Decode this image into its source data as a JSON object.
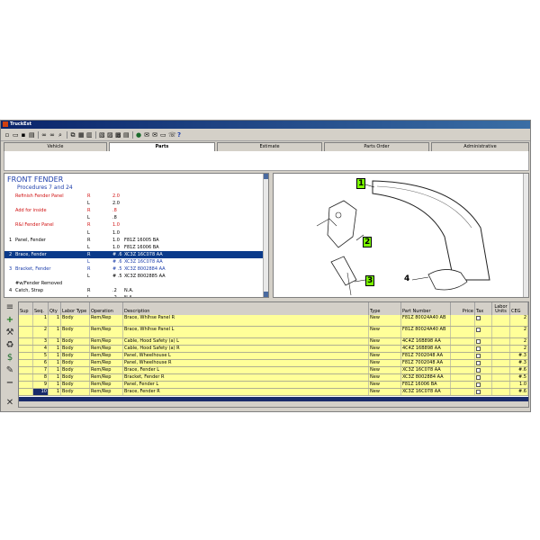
{
  "window": {
    "title": "TruckEst"
  },
  "toolbar": {
    "icons": [
      "new-icon",
      "open-icon",
      "save-icon",
      "print-icon",
      "binoculars-icon",
      "binoculars-prev-icon",
      "zoom-icon",
      "copy-icon",
      "paste-icon",
      "clipboard-icon",
      "image-icon",
      "picture-icon",
      "calculator-icon",
      "notes-icon",
      "globe-icon",
      "mail-icon",
      "mail-open-icon",
      "monitor-icon",
      "phone-icon",
      "help-icon"
    ]
  },
  "tabs": [
    {
      "label": "Vehicle",
      "active": false
    },
    {
      "label": "Parts",
      "active": true
    },
    {
      "label": "Estimate",
      "active": false
    },
    {
      "label": "Parts Order",
      "active": false
    },
    {
      "label": "Administrative",
      "active": false
    }
  ],
  "parts_list": {
    "title": "FRONT FENDER",
    "subtitle": "Procedures 7 and 24",
    "rows": [
      {
        "num": "",
        "name": "Refinish Fender Panel",
        "side": "R",
        "qty": "2.0",
        "part": "",
        "style": "red"
      },
      {
        "num": "",
        "name": "",
        "side": "L",
        "qty": "2.0",
        "part": "",
        "style": ""
      },
      {
        "num": "",
        "name": "Add for inside",
        "side": "R",
        "qty": ".8",
        "part": "",
        "style": "red"
      },
      {
        "num": "",
        "name": "",
        "side": "L",
        "qty": ".8",
        "part": "",
        "style": ""
      },
      {
        "num": "",
        "name": "R&I Fender Panel",
        "side": "R",
        "qty": "1.0",
        "part": "",
        "style": "red"
      },
      {
        "num": "",
        "name": "",
        "side": "L",
        "qty": "1.0",
        "part": "",
        "style": ""
      },
      {
        "num": "1",
        "name": "Panel, Fender",
        "side": "R",
        "qty": "1.0",
        "part": "F81Z 16005 BA",
        "style": ""
      },
      {
        "num": "",
        "name": "",
        "side": "L",
        "qty": "1.0",
        "part": "F81Z 16006 BA",
        "style": ""
      },
      {
        "num": "2",
        "name": "Brace, Fender",
        "side": "R",
        "qty": "# .6",
        "part": "XC3Z 16C078 AA",
        "style": "sel"
      },
      {
        "num": "",
        "name": "",
        "side": "L",
        "qty": "# .6",
        "part": "XC3Z 16C078 AA",
        "style": "blue"
      },
      {
        "num": "3",
        "name": "Bracket, Fender",
        "side": "R",
        "qty": "# .5",
        "part": "XC3Z 8002884 AA",
        "style": "blue"
      },
      {
        "num": "",
        "name": "",
        "side": "L",
        "qty": "# .5",
        "part": "XC3Z 8002885 AA",
        "style": ""
      },
      {
        "num": "",
        "name": "#w/Fender Removed",
        "side": "",
        "qty": "",
        "part": "",
        "style": ""
      },
      {
        "num": "4",
        "name": "Catch, Strap",
        "side": "R",
        "qty": ".2",
        "part": "N.A.",
        "style": ""
      },
      {
        "num": "",
        "name": "",
        "side": "L",
        "qty": ".2",
        "part": "N.A.",
        "style": ""
      }
    ]
  },
  "diagram": {
    "callouts": [
      "1",
      "2",
      "3",
      "4"
    ]
  },
  "sidebar": {
    "icons": [
      "stack-icon",
      "add-icon",
      "tools-icon",
      "recycle-icon",
      "dollar-icon",
      "wrench-icon",
      "minus-icon",
      "close-icon"
    ]
  },
  "grid": {
    "headers": [
      "Sup",
      "Seq.",
      "Qty",
      "Labor Type",
      "Operation",
      "Description",
      "Type",
      "Part Number",
      "Price",
      "Tax",
      "Labor Units",
      "CEG"
    ],
    "rows": [
      {
        "sup": "",
        "seq": "1",
        "qty": "1",
        "labor": "Body",
        "op": "Rem/Rep",
        "desc": "Brace, Whlhse Panel R",
        "type": "New",
        "part": "F81Z 80024A40 AB",
        "price": "",
        "units": "",
        "ceg": "2"
      },
      {
        "sup": "",
        "seq": "2",
        "qty": "1",
        "labor": "Body",
        "op": "Rem/Rep",
        "desc": "Brace, Whlhse Panel  L",
        "type": "New",
        "part": "F81Z 80024A40 AB",
        "price": "",
        "units": "",
        "ceg": "2"
      },
      {
        "sup": "",
        "seq": "3",
        "qty": "1",
        "labor": "Body",
        "op": "Rem/Rep",
        "desc": "Cable, Hood Safety (a)  L",
        "type": "New",
        "part": "4C4Z 16B898 AA",
        "price": "",
        "units": "",
        "ceg": "2"
      },
      {
        "sup": "",
        "seq": "4",
        "qty": "1",
        "labor": "Body",
        "op": "Rem/Rep",
        "desc": "Cable, Hood Safety (a) R",
        "type": "New",
        "part": "4C4Z 16B898 AA",
        "price": "",
        "units": "",
        "ceg": "2"
      },
      {
        "sup": "",
        "seq": "5",
        "qty": "1",
        "labor": "Body",
        "op": "Rem/Rep",
        "desc": "Panel, Wheelhouse  L",
        "type": "New",
        "part": "F81Z 7002048 AA",
        "price": "",
        "units": "",
        "ceg": "#.3"
      },
      {
        "sup": "",
        "seq": "6",
        "qty": "1",
        "labor": "Body",
        "op": "Rem/Rep",
        "desc": "Panel, Wheelhouse R",
        "type": "New",
        "part": "F81Z 7002048 AA",
        "price": "",
        "units": "",
        "ceg": "#.3"
      },
      {
        "sup": "",
        "seq": "7",
        "qty": "1",
        "labor": "Body",
        "op": "Rem/Rep",
        "desc": "Brace, Fender  L",
        "type": "New",
        "part": "XC3Z 16C078 AA",
        "price": "",
        "units": "",
        "ceg": "#.6"
      },
      {
        "sup": "",
        "seq": "8",
        "qty": "1",
        "labor": "Body",
        "op": "Rem/Rep",
        "desc": "Bracket, Fender R",
        "type": "New",
        "part": "XC3Z 8002884 AA",
        "price": "",
        "units": "",
        "ceg": "#.5"
      },
      {
        "sup": "",
        "seq": "9",
        "qty": "1",
        "labor": "Body",
        "op": "Rem/Rep",
        "desc": "Panel, Fender  L",
        "type": "New",
        "part": "F81Z 16006 BA",
        "price": "",
        "units": "",
        "ceg": "1.0"
      },
      {
        "sup": "",
        "seq": "10",
        "qty": "1",
        "labor": "Body",
        "op": "Rem/Rep",
        "desc": "Brace, Fender R",
        "type": "New",
        "part": "XC3Z 16C078 AA",
        "price": "",
        "units": "",
        "ceg": "#.6"
      }
    ]
  },
  "colors": {
    "selection": "#0a3a8a",
    "row_bg": "#ffff99",
    "title_blue": "#1a3caa",
    "labor_red": "#d01010",
    "callout_green": "#7cfc00"
  }
}
